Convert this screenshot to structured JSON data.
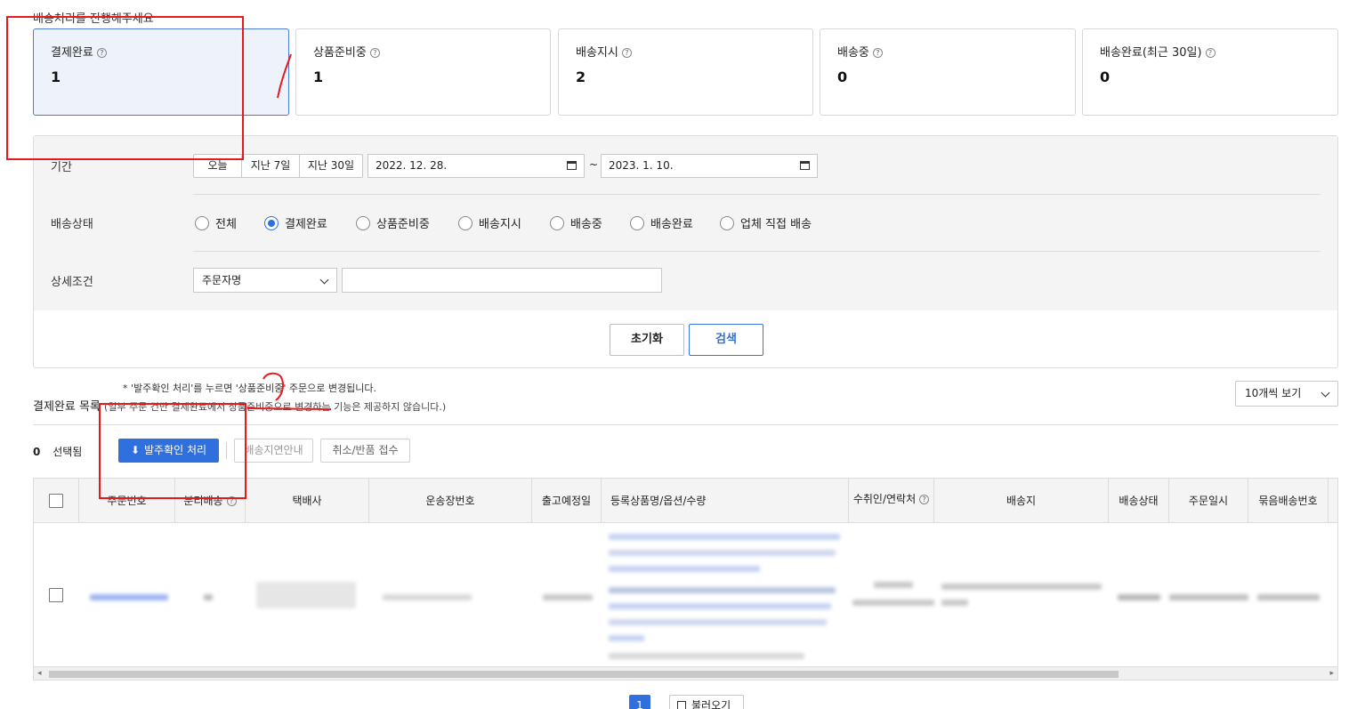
{
  "page": {
    "heading": "배송처리를 진행해주세요"
  },
  "stats": [
    {
      "label": "결제완료",
      "value": "1"
    },
    {
      "label": "상품준비중",
      "value": "1"
    },
    {
      "label": "배송지시",
      "value": "2"
    },
    {
      "label": "배송중",
      "value": "0"
    },
    {
      "label": "배송완료(최근 30일)",
      "value": "0"
    }
  ],
  "filter": {
    "period_label": "기간",
    "period_buttons": [
      "오늘",
      "지난 7일",
      "지난 30일"
    ],
    "date_from": "2022. 12. 28.",
    "date_tilde": "~",
    "date_to": "2023. 1. 10.",
    "status_label": "배송상태",
    "status_options": [
      "전체",
      "결제완료",
      "상품준비중",
      "배송지시",
      "배송중",
      "배송완료",
      "업체 직접 배송"
    ],
    "status_selected": "결제완료",
    "detail_label": "상세조건",
    "detail_select": "주문자명",
    "detail_input": "",
    "reset_label": "초기화",
    "search_label": "검색"
  },
  "list": {
    "note": "* '발주확인 처리'를 누르면 '상품준비중' 주문으로 변경됩니다.",
    "title": "결제완료 목록",
    "subtitle": "(일부 주문 건만 결제완료에서 상품준비중으로 변경하는 기능은 제공하지 않습니다.)",
    "per_page": "10개씩 보기",
    "selected_count": "0",
    "selected_label": "선택됨",
    "confirm_order_btn": "발주확인 처리",
    "delay_notice_btn": "배송지연안내",
    "cancel_return_btn": "취소/반품 접수"
  },
  "table": {
    "columns": [
      "주문번호",
      "분리배송",
      "택배사",
      "운송장번호",
      "출고예정일",
      "등록상품명/옵션/수량",
      "수취인/연락처",
      "배송지",
      "배송상태",
      "주문일시",
      "묶음배송번호"
    ]
  },
  "pagination": {
    "current_page": "1",
    "reload_label": "불러오기"
  },
  "colors": {
    "accent": "#2f6fde",
    "annotation": "#e8191b"
  }
}
